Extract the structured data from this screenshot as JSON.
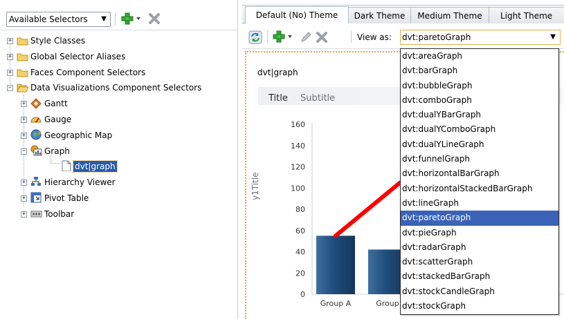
{
  "left_toolbar": {
    "selector_dropdown_value": "Available Selectors"
  },
  "tree": {
    "style_classes": "Style Classes",
    "global_aliases": "Global Selector Aliases",
    "faces": "Faces Component Selectors",
    "dvt": "Data Visualizations Component Selectors",
    "gantt": "Gantt",
    "gauge": "Gauge",
    "geo_map": "Geographic Map",
    "graph": "Graph",
    "dvt_graph": "dvt|graph",
    "hierarchy": "Hierarchy Viewer",
    "pivot": "Pivot Table",
    "toolbar": "Toolbar"
  },
  "tabs": [
    {
      "label": "Default (No) Theme",
      "active": true
    },
    {
      "label": "Dark Theme",
      "active": false
    },
    {
      "label": "Medium Theme",
      "active": false
    },
    {
      "label": "Light Theme",
      "active": false
    }
  ],
  "right_toolbar": {
    "view_as_label": "View as:",
    "view_as_value": "dvt:paretoGraph"
  },
  "preview": {
    "selector_name": "dvt|graph",
    "graph_title": "Title",
    "graph_subtitle": "Subtitle",
    "y_axis_title": "y1Title"
  },
  "chart_data": {
    "type": "bar",
    "categories": [
      "Group A",
      "Group B"
    ],
    "category_labels_visible": [
      "Group A",
      "Group"
    ],
    "values": [
      55,
      42
    ],
    "line_series": [
      55,
      105
    ],
    "yticks": [
      0,
      20,
      40,
      60,
      80,
      100,
      120,
      140,
      160
    ],
    "ylim": [
      0,
      160
    ],
    "ylabel": "y1Title",
    "title": "Title",
    "subtitle": "Subtitle",
    "colors": {
      "bar": "#1f4d7d",
      "line": "#ff0000"
    },
    "grid": false
  },
  "dropdown": {
    "items": [
      "dvt:areaGraph",
      "dvt:barGraph",
      "dvt:bubbleGraph",
      "dvt:comboGraph",
      "dvt:dualYBarGraph",
      "dvt:dualYComboGraph",
      "dvt:dualYLineGraph",
      "dvt:funnelGraph",
      "dvt:horizontalBarGraph",
      "dvt:horizontalStackedBarGraph",
      "dvt:lineGraph",
      "dvt:paretoGraph",
      "dvt:pieGraph",
      "dvt:radarGraph",
      "dvt:scatterGraph",
      "dvt:stackedBarGraph",
      "dvt:stockCandleGraph",
      "dvt:stockGraph"
    ],
    "selected": "dvt:paretoGraph"
  },
  "icons": {
    "folder": "folder-icon",
    "open_folder": "open-folder-icon",
    "add": "add-icon",
    "delete": "delete-icon",
    "refresh": "refresh-icon",
    "edit": "edit-icon"
  }
}
